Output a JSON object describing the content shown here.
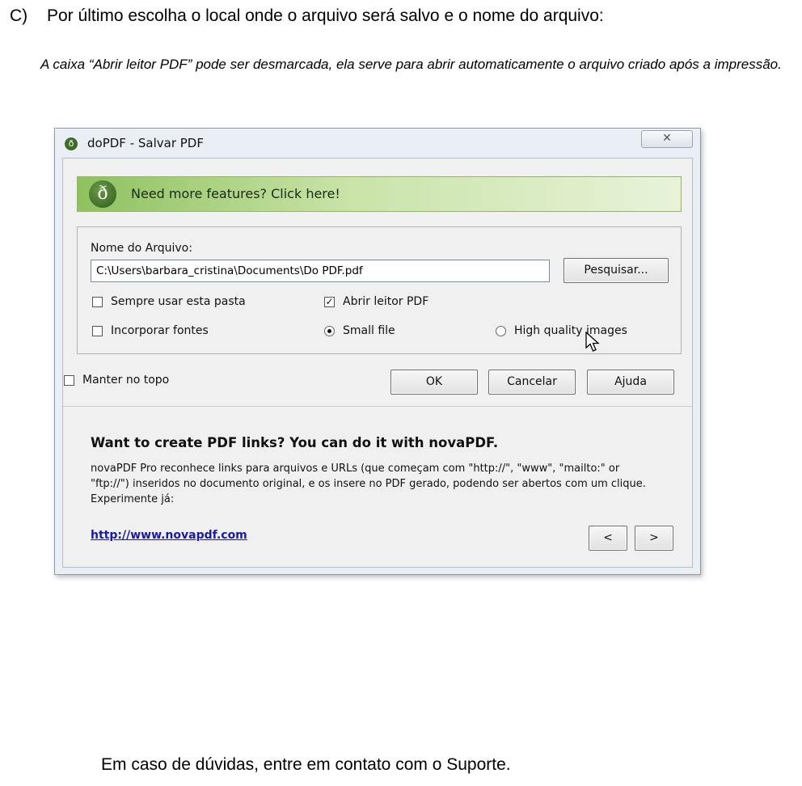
{
  "document": {
    "step_marker": "C)",
    "heading": "Por último escolha o local onde o arquivo será salvo e o nome do arquivo:",
    "note": "A caixa “Abrir leitor PDF” pode ser desmarcada, ela serve para abrir automaticamente o arquivo criado após a impressão.",
    "footer": "Em caso de dúvidas, entre em contato com o Suporte."
  },
  "dialog": {
    "title": "doPDF - Salvar PDF",
    "app_icon": "dopdf-logo-icon",
    "close_glyph": "✕",
    "promo": {
      "icon": "dopdf-logo-icon",
      "text": "Need more features? Click here!"
    },
    "file": {
      "label": "Nome do Arquivo:",
      "value": "C:\\Users\\barbara_cristina\\Documents\\Do PDF.pdf",
      "browse_label": "Pesquisar..."
    },
    "options": {
      "always_use_folder": {
        "label": "Sempre usar esta pasta",
        "checked": false
      },
      "open_pdf_reader": {
        "label": "Abrir leitor PDF",
        "checked": true
      },
      "embed_fonts": {
        "label": "Incorporar fontes",
        "checked": false
      },
      "small_file": {
        "label": "Small file",
        "selected": true
      },
      "high_quality": {
        "label": "High quality images",
        "selected": false
      }
    },
    "keep_on_top": {
      "label": "Manter no topo",
      "checked": false
    },
    "buttons": {
      "ok": "OK",
      "cancel": "Cancelar",
      "help": "Ajuda"
    },
    "info": {
      "title": "Want to create PDF links? You can do it with novaPDF.",
      "text": "novaPDF Pro reconhece links para arquivos e URLs (que começam com \"http://\", \"www\", \"mailto:\" or \"ftp://\") inseridos no documento original, e os insere no PDF gerado, podendo ser abertos com um clique. Experimente já:",
      "link": "http://www.novapdf.com",
      "prev": "<",
      "next": ">"
    }
  }
}
